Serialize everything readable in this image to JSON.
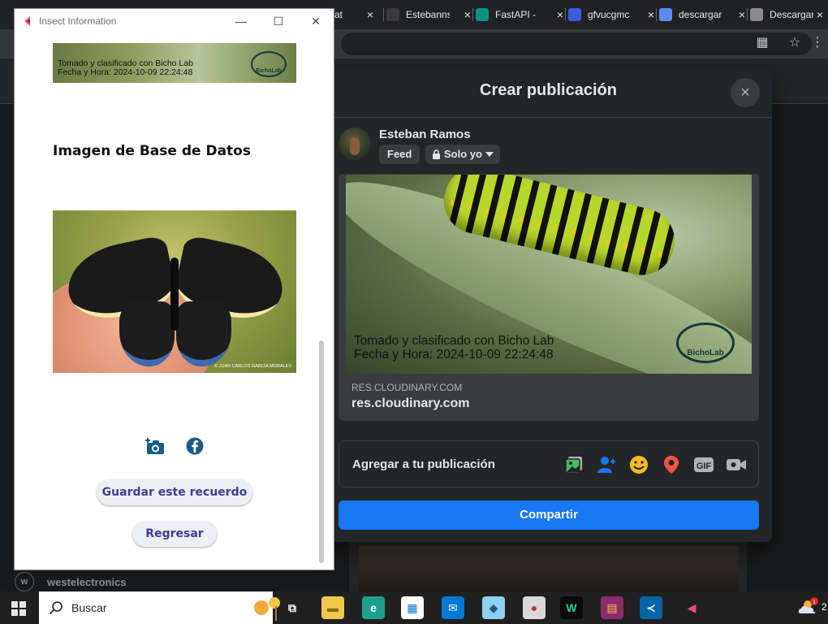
{
  "browser": {
    "tabs": [
      {
        "title": "What",
        "icon": "whatsapp-icon",
        "color": "#2fb45a"
      },
      {
        "title": "Estebanns",
        "icon": "github-icon",
        "color": "#3a3a3a"
      },
      {
        "title": "FastAPI -",
        "icon": "fastapi-icon",
        "color": "#059484"
      },
      {
        "title": "gfvucgmc",
        "icon": "server-icon",
        "color": "#3b5bdb"
      },
      {
        "title": "descargar",
        "icon": "search-icon",
        "color": "#5b8def"
      },
      {
        "title": "Descargar",
        "icon": "document-icon",
        "color": "#8a8a8a"
      }
    ],
    "tab_close_glyph": "×"
  },
  "facebook_dialog": {
    "title": "Crear publicación",
    "close_glyph": "×",
    "user_name": "Esteban Ramos",
    "feed_label": "Feed",
    "privacy_label": "Solo yo",
    "preview": {
      "watermark_line1": "Tomado y clasificado con Bicho Lab",
      "watermark_line2": "Fecha y Hora: 2024-10-09 22:24:48",
      "logo_text": "BichoLab",
      "domain_caps": "RES.CLOUDINARY.COM",
      "domain": "res.cloudinary.com"
    },
    "add_to_post_label": "Agregar a tu publicación",
    "add_icons": [
      {
        "name": "photo-video-icon",
        "color": "#45bd62"
      },
      {
        "name": "tag-people-icon",
        "color": "#1877f2"
      },
      {
        "name": "feeling-emoji-icon",
        "color": "#f7b928"
      },
      {
        "name": "check-in-location-icon",
        "color": "#f5533d"
      },
      {
        "name": "gif-icon",
        "color": "#b0b3b8"
      },
      {
        "name": "live-video-icon",
        "color": "#b0b3b8"
      }
    ],
    "gif_text": "GIF",
    "share_label": "Compartir",
    "colors": {
      "share": "#1877f2",
      "surface": "#242526"
    }
  },
  "insect_window": {
    "title": "Insect Information",
    "controls": {
      "minimize": "—",
      "maximize": "☐",
      "close": "✕"
    },
    "top_image": {
      "watermark_line1": "Tomado y clasificado con Bicho Lab",
      "watermark_line2": "Fecha y Hora: 2024-10-09 22:24:48",
      "logo_text": "BichoLab"
    },
    "db_heading": "Imagen de Base de Datos",
    "db_image_credit": "© JUAN CARLOS GARCÍA MORALES",
    "save_label": "Guardar este recuerdo",
    "back_label": "Regresar",
    "accent_color": "#3f3d8f"
  },
  "page_background": {
    "account_name": "westelectronics",
    "account_avatar": "w"
  },
  "taskbar": {
    "search_placeholder": "Buscar",
    "apps": [
      {
        "name": "task-view-icon",
        "glyph": "⧉",
        "bg": "#202020",
        "fg": "#ffffff"
      },
      {
        "name": "file-explorer-icon",
        "glyph": "▬",
        "bg": "#f2c94c",
        "fg": "#8a6d0f"
      },
      {
        "name": "edge-icon",
        "glyph": "e",
        "bg": "#1f9f8c",
        "fg": "#ffffff"
      },
      {
        "name": "store-icon",
        "glyph": "▦",
        "bg": "#ffffff",
        "fg": "#0078d4"
      },
      {
        "name": "mail-icon",
        "glyph": "✉",
        "bg": "#0078d4",
        "fg": "#ffffff"
      },
      {
        "name": "notes-app-icon",
        "glyph": "◆",
        "bg": "#8fd0f0",
        "fg": "#245c7a"
      },
      {
        "name": "paint-app-icon",
        "glyph": "●",
        "bg": "#d9d9d9",
        "fg": "#c0392b"
      },
      {
        "name": "webstorm-icon",
        "glyph": "W",
        "bg": "#0a0a0a",
        "fg": "#21d789"
      },
      {
        "name": "winrar-icon",
        "glyph": "▤",
        "bg": "#8e2c6b",
        "fg": "#f2c94c"
      },
      {
        "name": "vscode-icon",
        "glyph": "≺",
        "bg": "#0065a9",
        "fg": "#ffffff"
      },
      {
        "name": "flutter-app-icon",
        "glyph": "◀",
        "bg": "#202020",
        "fg": "#f04f7d"
      }
    ],
    "notification_count": "1",
    "clock_fragment": "2"
  }
}
